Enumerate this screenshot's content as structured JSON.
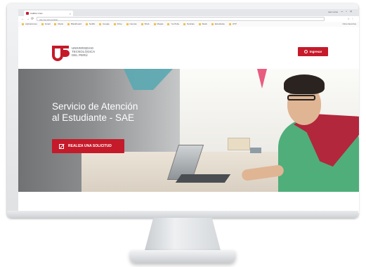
{
  "browser": {
    "tab_title": "Califica Unes",
    "user_label": "user name",
    "url": "sae.utp.edu.pe/sae/",
    "bookmarks": [
      "Aplicaciones",
      "Gmail",
      "Diario",
      "Blackboard",
      "Netflix",
      "Google",
      "Drive",
      "Canvas",
      "SIGA",
      "Mapas",
      "YouTube",
      "Noticias",
      "Slack",
      "Estudiante",
      "UTP",
      "Otros favoritos"
    ]
  },
  "header": {
    "logo_line1": "UNIVERSIDAD",
    "logo_line2": "TECNOLÓGICA",
    "logo_line3": "DEL PERÚ",
    "login_label": "Ingresar"
  },
  "hero": {
    "title_line1": "Servicio de Atención",
    "title_line2": "al Estudiante - SAE",
    "cta_label": "REALIZA UNA SOLICITUD"
  },
  "colors": {
    "brand_red": "#c51a2a",
    "logo_gray": "#8a8c8f"
  },
  "icons": {
    "login": "login-circle-icon",
    "request": "edit-form-icon"
  }
}
